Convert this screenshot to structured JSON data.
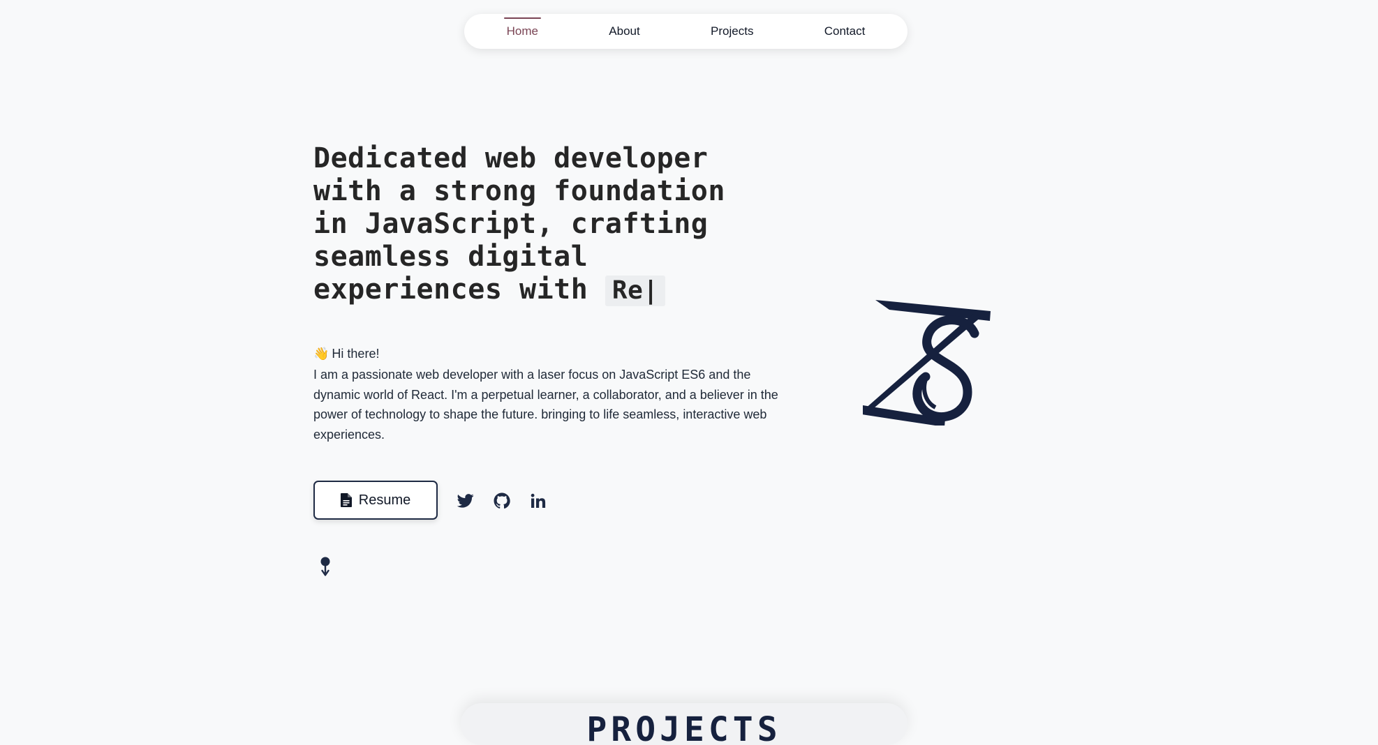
{
  "nav": {
    "items": [
      {
        "label": "Home",
        "active": true
      },
      {
        "label": "About",
        "active": false
      },
      {
        "label": "Projects",
        "active": false
      },
      {
        "label": "Contact",
        "active": false
      }
    ]
  },
  "hero": {
    "heading_lines": [
      "Dedicated web developer",
      "with a strong foundation",
      "in JavaScript, crafting",
      "seamless digital",
      "experiences with"
    ],
    "typed_text": "Re|",
    "greeting_emoji": "👋",
    "greeting": "Hi there!",
    "intro": "I am a passionate web developer with a laser focus on JavaScript ES6 and the dynamic world of React. I'm a perpetual learner, a collaborator, and a believer in the power of technology to shape the future. bringing to life seamless, interactive web experiences."
  },
  "actions": {
    "resume_label": "Resume",
    "social_icons": [
      "twitter-icon",
      "github-icon",
      "linkedin-icon"
    ]
  },
  "logo": {
    "monogram": "ZS"
  },
  "next_section": {
    "title": "PROJECTS"
  },
  "colors": {
    "background": "#f8f9fa",
    "accent": "#7a4454",
    "navy": "#16213e",
    "text": "#1f2937"
  }
}
